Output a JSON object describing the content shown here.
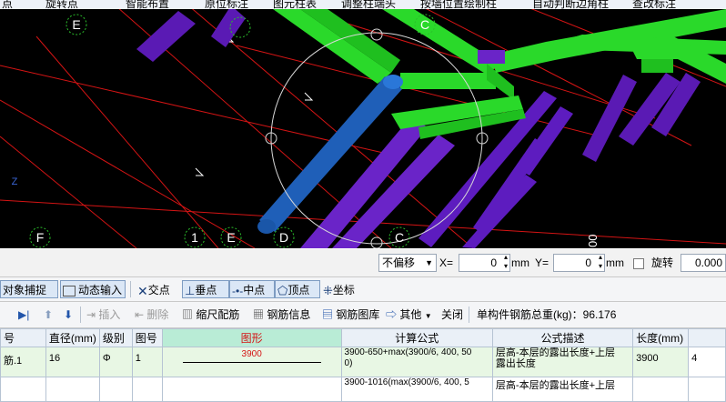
{
  "top_toolbar": {
    "items": [
      "点",
      "旋转点",
      "智能布置",
      "原位标注",
      "图元柱表",
      "调整柱端头",
      "按墙位置绘制柱",
      "自动判断边角柱",
      "查改标注"
    ]
  },
  "viewport": {
    "axis_labels": [
      "E",
      "C",
      "F",
      "1",
      "E",
      "D",
      "C"
    ],
    "z_axis": "Z",
    "ruler_digits": "00"
  },
  "statusbar": {
    "offset_select": "不偏移",
    "x_label": "X=",
    "x_value": "0",
    "x_unit": "mm",
    "y_label": "Y=",
    "y_value": "0",
    "y_unit": "mm",
    "rotate_label": "旋转",
    "rotate_value": "0.000"
  },
  "snapbar": {
    "object_snap": "对象捕捉",
    "dynamic_input": "动态输入",
    "intersection": "交点",
    "perpendicular": "垂点",
    "midpoint": "中点",
    "vertex": "顶点",
    "coordinate": "坐标"
  },
  "grid_toolbar": {
    "insert": "插入",
    "delete": "删除",
    "scale_rebar": "缩尺配筋",
    "rebar_info": "钢筋信息",
    "rebar_library": "钢筋图库",
    "other": "其他",
    "close": "关闭",
    "total_weight": "单构件钢筋总重(kg)：96.176"
  },
  "table": {
    "headers": [
      "号",
      "直径(mm)",
      "级别",
      "图号",
      "图形",
      "计算公式",
      "公式描述",
      "长度(mm)",
      ""
    ],
    "rows": [
      {
        "name": "筋.1",
        "diameter": "16",
        "grade": "Φ",
        "figure_no": "1",
        "shape_value": "3900",
        "formula_line1": "3900-650+max(3900/6, 400, 50",
        "formula_line2": "0)",
        "description_line1": "层高-本层的露出长度+上层",
        "description_line2": "露出长度",
        "length": "3900",
        "count": "4"
      },
      {
        "name": "",
        "diameter": "",
        "grade": "",
        "figure_no": "",
        "shape_value": "",
        "formula_line1": "3900-1016(max(3900/6, 400, 5",
        "formula_line2": "",
        "description_line1": "层高-本层的露出长度+上层",
        "description_line2": "",
        "length": "",
        "count": ""
      }
    ]
  },
  "colors": {
    "beam_green": "#2ad92a",
    "column_purple": "#6a24c8",
    "selected_blue": "#1f5fb8",
    "axis_grid_red": "#d41414",
    "viewport_bg": "#000000"
  }
}
